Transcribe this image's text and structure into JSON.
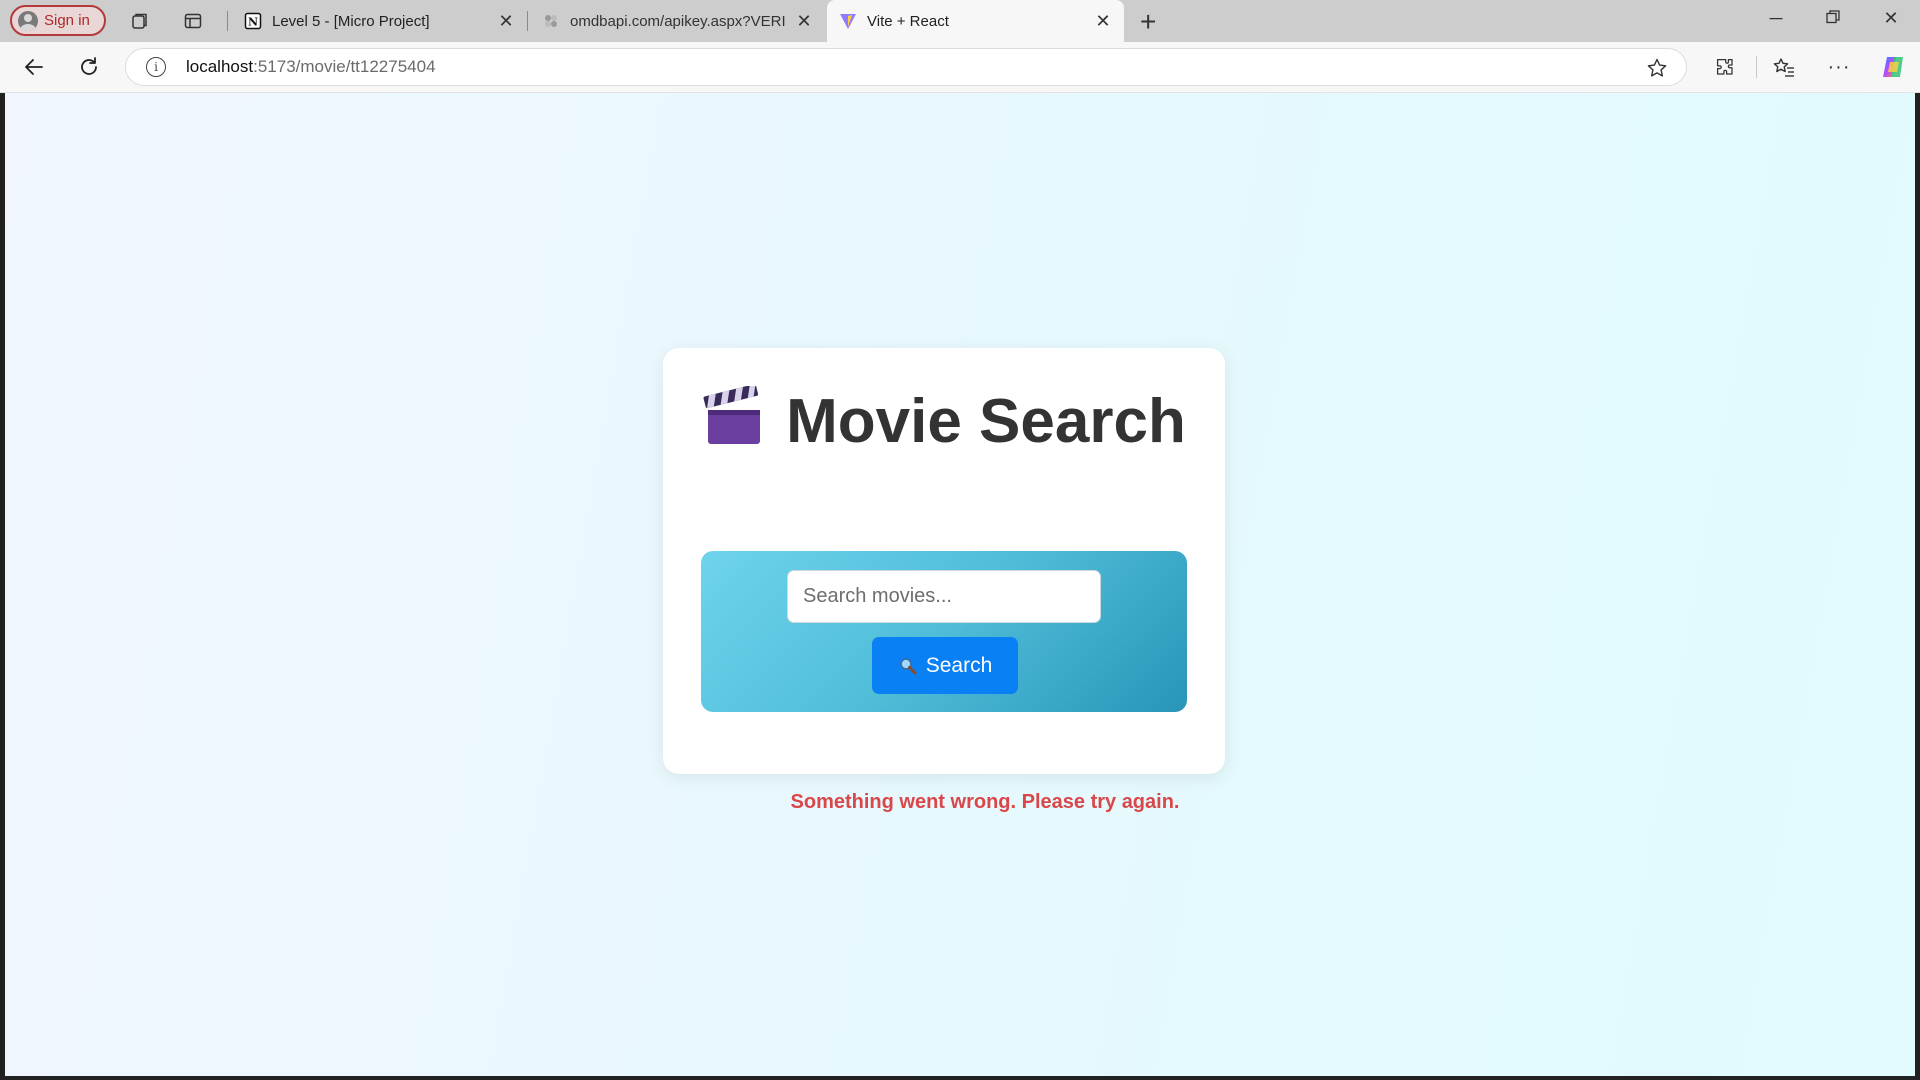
{
  "browser": {
    "sign_in_label": "Sign in",
    "tabs": [
      {
        "title": "Level 5 - [Micro Project]",
        "favicon": "notion-icon"
      },
      {
        "title": "omdbapi.com/apikey.aspx?VERIFY",
        "favicon": "omdb-icon"
      },
      {
        "title": "Vite + React",
        "favicon": "vite-icon",
        "active": true
      }
    ],
    "url_host": "localhost",
    "url_path": ":5173/movie/tt12275404"
  },
  "app": {
    "title_emoji": "clapperboard-icon",
    "title": "Movie Search",
    "search_placeholder": "Search movies...",
    "search_value": "",
    "search_button_label": "Search",
    "error_message": "Something went wrong. Please try again."
  },
  "colors": {
    "accent": "#0a80f5",
    "error": "#d9474a",
    "panel_gradient_start": "#6fd3ec",
    "panel_gradient_end": "#2895b9"
  }
}
